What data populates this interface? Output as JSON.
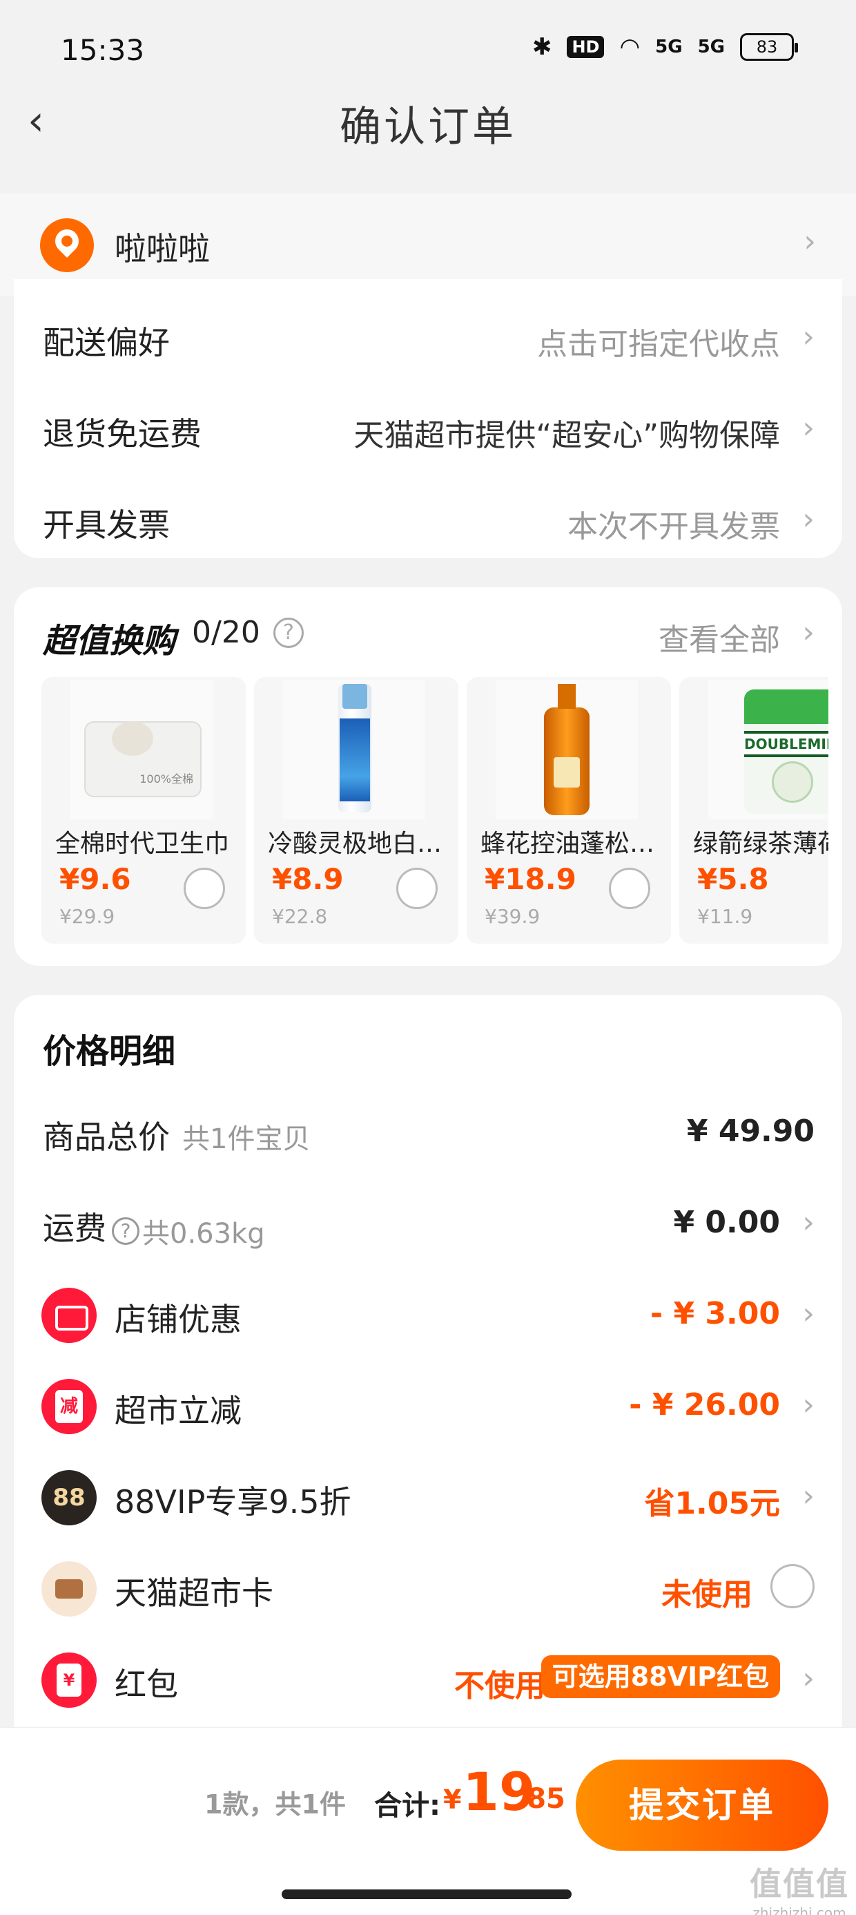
{
  "status_bar": {
    "time": "15:33",
    "hd": "HD",
    "signal1": "5G",
    "signal2": "5G",
    "battery": "83"
  },
  "nav": {
    "back_icon": "chevron-left-icon",
    "title": "确认订单"
  },
  "address": {
    "name": "啦啦啦",
    "icon": "location-pin-icon"
  },
  "order_options": [
    {
      "label": "配送偏好",
      "value": "点击可指定代收点"
    },
    {
      "label": "退货免运费",
      "value": "天猫超市提供“超安心”购物保障"
    },
    {
      "label": "开具发票",
      "value": "本次不开具发票"
    }
  ],
  "exchange": {
    "title": "超值换购",
    "count": "0/20",
    "view_all": "查看全部",
    "products": [
      {
        "name": "全棉时代卫生巾",
        "price": "¥9.6",
        "original": "¥29.9"
      },
      {
        "name": "冷酸灵极地白牙膏",
        "price": "¥8.9",
        "original": "¥22.8"
      },
      {
        "name": "蜂花控油蓬松洗发水",
        "price": "¥18.9",
        "original": "¥39.9"
      },
      {
        "name": "绿箭绿茶薄荷糖",
        "price": "¥5.8",
        "original": "¥11.9"
      }
    ]
  },
  "price_detail": {
    "title": "价格明细",
    "goods_total": {
      "label": "商品总价",
      "sub": "共1件宝贝",
      "value": "¥ 49.90"
    },
    "shipping": {
      "label": "运费",
      "weight": "共0.63kg",
      "value": "¥ 0.00"
    },
    "shop_discount": {
      "label": "店铺优惠",
      "value": "- ¥ 3.00"
    },
    "market_reduce": {
      "label": "超市立减",
      "icon_text": "减",
      "value": "- ¥ 26.00"
    },
    "vip": {
      "icon_text": "88",
      "label": "88VIP专享9.5折",
      "value": "省1.05元"
    },
    "market_card": {
      "label": "天猫超市卡",
      "value": "未使用"
    },
    "red_packet": {
      "label": "红包",
      "icon_text": "¥",
      "value": "不使用",
      "pill": "可选用88VIP红包"
    }
  },
  "footer": {
    "summary": "1款，共1件",
    "total_label": "合计:",
    "currency": "¥",
    "total_int": "19",
    "total_dec": ".85",
    "submit": "提交订单",
    "watermark_logo": "值值值",
    "watermark_url": "zhizhizhi.com"
  },
  "colors": {
    "accent": "#ff5000",
    "gradient_start": "#ff9000",
    "red_icon": "#ff1a3a"
  }
}
